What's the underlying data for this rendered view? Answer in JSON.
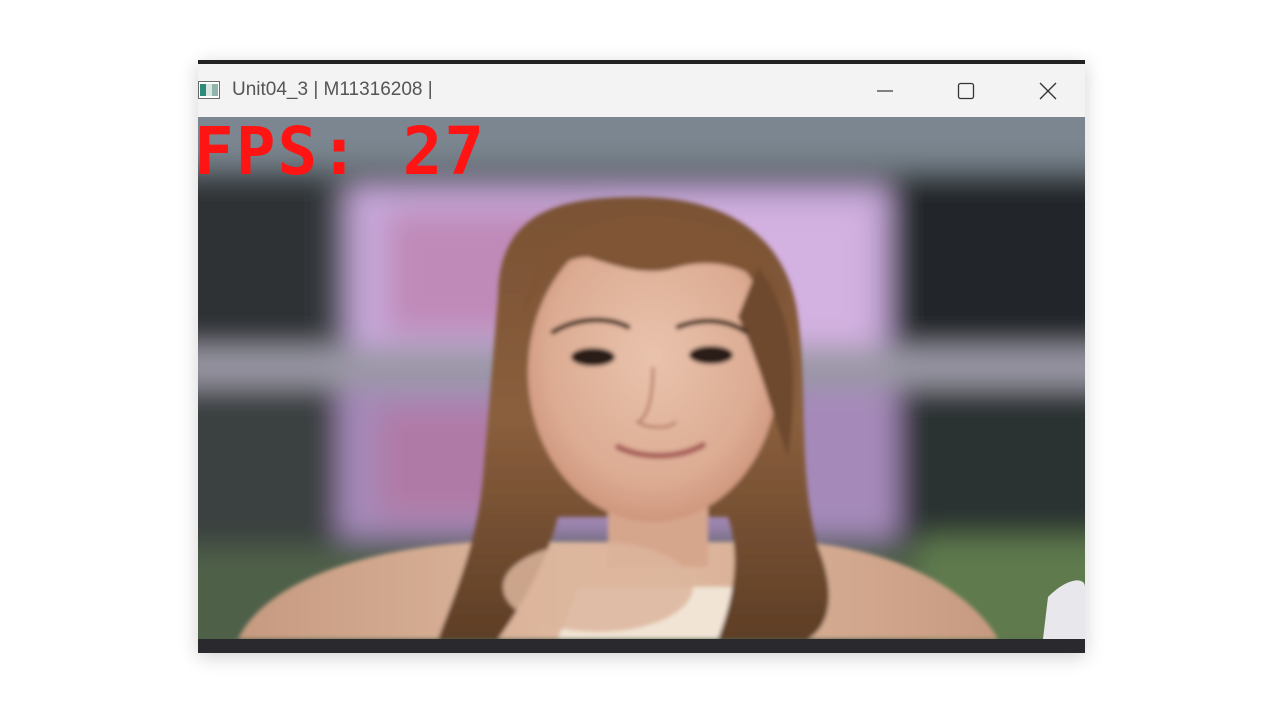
{
  "window": {
    "title": "Unit04_3 | M11316208 |",
    "icon": "opencv-window-icon",
    "controls": {
      "minimize_icon": "minimize-icon",
      "maximize_icon": "maximize-icon",
      "close_icon": "close-icon"
    }
  },
  "video": {
    "overlay_text": "FPS: 27",
    "overlay_color": "#ff1414"
  }
}
